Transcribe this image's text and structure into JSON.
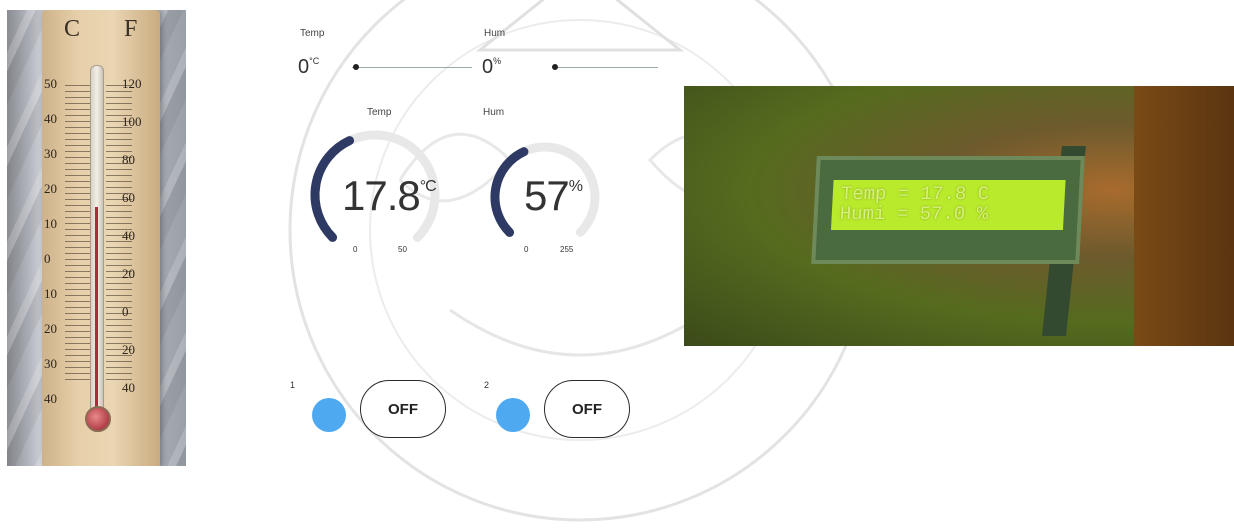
{
  "thermometer_photo": {
    "unit_c": "C",
    "unit_f": "F",
    "celsius_ticks": [
      "50",
      "40",
      "30",
      "20",
      "10",
      "0",
      "10",
      "20",
      "30",
      "40"
    ],
    "fahrenheit_ticks": [
      "120",
      "100",
      "80",
      "60",
      "40",
      "20",
      "0",
      "20",
      "40"
    ],
    "reading_fraction": 0.62
  },
  "lcd_photo": {
    "line1": "Temp = 17.8 C",
    "line2": "Humi = 57.0 %"
  },
  "app": {
    "top": {
      "temp_label": "Temp",
      "temp_value": "0",
      "temp_unit": "°C",
      "hum_label": "Hum",
      "hum_value": "0",
      "hum_unit": "%"
    },
    "gauges": {
      "temp": {
        "label": "Temp",
        "value": "17.8",
        "unit": "°C",
        "min": "0",
        "max": "50",
        "numeric": 17.8,
        "range": [
          0,
          50
        ]
      },
      "hum": {
        "label": "Hum",
        "value": "57",
        "unit": "%",
        "min": "0",
        "max": "255",
        "numeric": 57,
        "range": [
          0,
          255
        ]
      }
    },
    "controls": [
      {
        "number": "1",
        "state": "OFF"
      },
      {
        "number": "2",
        "state": "OFF"
      }
    ],
    "colors": {
      "gauge_fill": "#2e3a63",
      "gauge_track": "#e8e8e8",
      "led": "#4ea9f0"
    }
  }
}
